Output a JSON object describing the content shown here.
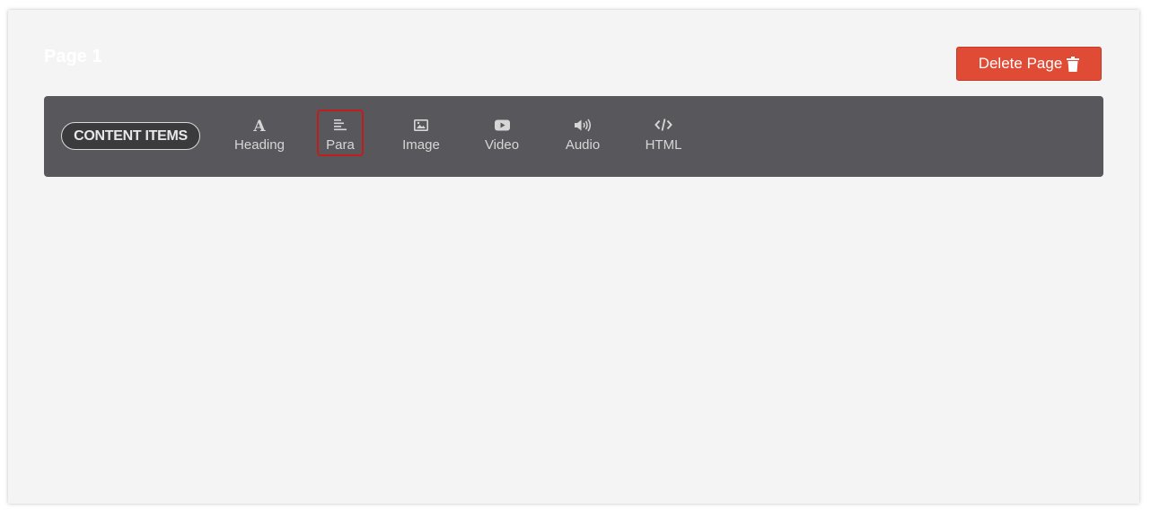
{
  "page": {
    "title": "Page 1",
    "delete_label": "Delete Page"
  },
  "toolbar": {
    "section_label": "CONTENT ITEMS",
    "items": [
      {
        "label": "Heading",
        "icon": "heading-icon"
      },
      {
        "label": "Para",
        "icon": "paragraph-icon",
        "selected": true
      },
      {
        "label": "Image",
        "icon": "image-icon"
      },
      {
        "label": "Video",
        "icon": "video-icon"
      },
      {
        "label": "Audio",
        "icon": "audio-icon"
      },
      {
        "label": "HTML",
        "icon": "code-icon"
      }
    ]
  },
  "colors": {
    "delete_button": "#e04b36",
    "toolbar_background": "#58585c",
    "selection_outline": "#c21d1d"
  }
}
